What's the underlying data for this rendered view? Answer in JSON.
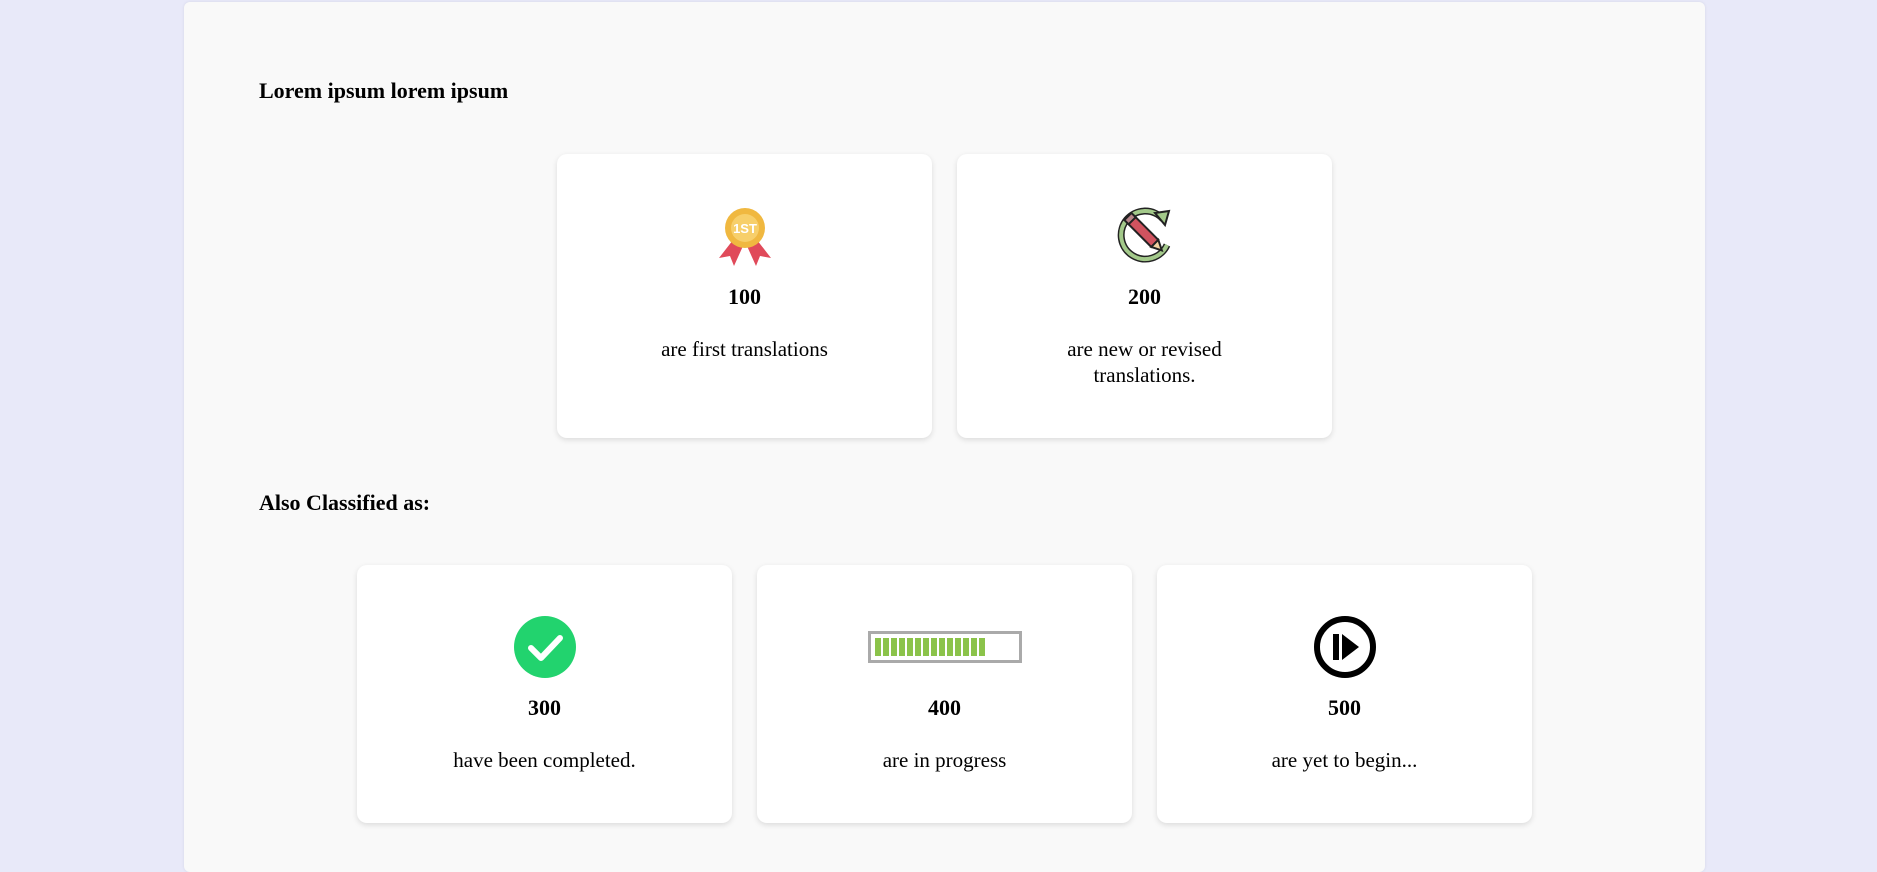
{
  "sections": {
    "primary_title": "Lorem ipsum lorem ipsum",
    "secondary_title": "Also Classified as:"
  },
  "cards": [
    {
      "icon": "first-place-medal-icon",
      "value": "100",
      "label": "are first translations"
    },
    {
      "icon": "revise-pencil-icon",
      "value": "200",
      "label": "are new or revised translations."
    },
    {
      "icon": "check-circle-icon",
      "value": "300",
      "label": "have been completed."
    },
    {
      "icon": "progress-bar-icon",
      "value": "400",
      "label": "are in progress"
    },
    {
      "icon": "play-circle-icon",
      "value": "500",
      "label": "are yet to begin..."
    }
  ],
  "colors": {
    "page_background": "#e8e9f9",
    "panel_background": "#f9f9f9",
    "card_background": "#ffffff",
    "check_green": "#22d36e",
    "progress_green": "#8bc34a",
    "medal_gold": "#f0b840",
    "ribbon_red": "#e04a5a"
  }
}
